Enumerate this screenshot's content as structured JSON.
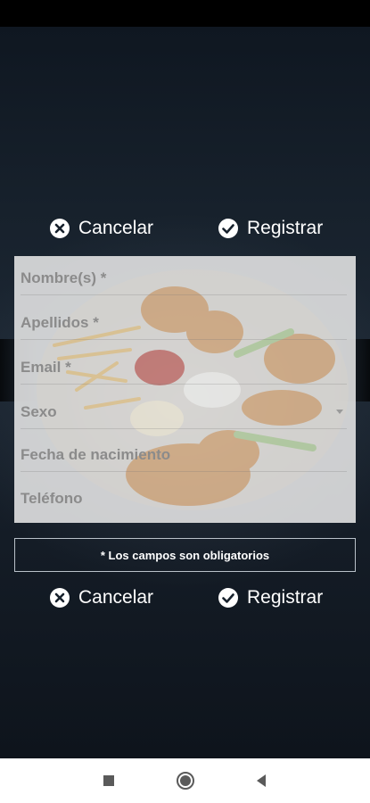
{
  "top_actions": {
    "cancel_label": "Cancelar",
    "register_label": "Registrar"
  },
  "form": {
    "fields": [
      {
        "label": "Nombre(s) *"
      },
      {
        "label": "Apellidos *"
      },
      {
        "label": "Email *"
      },
      {
        "label": "Sexo",
        "type": "dropdown"
      },
      {
        "label": "Fecha de nacimiento"
      },
      {
        "label": "Teléfono"
      }
    ]
  },
  "required_note": "* Los campos son obligatorios",
  "bottom_actions": {
    "cancel_label": "Cancelar",
    "register_label": "Registrar"
  },
  "nav_bar": {
    "icons": [
      "recent-apps-icon",
      "home-icon",
      "back-icon"
    ]
  },
  "colors": {
    "background": "#17212c",
    "panel": "#ebebeb",
    "text_on_dark": "#ffffff",
    "placeholder": "#8b8b8b"
  }
}
